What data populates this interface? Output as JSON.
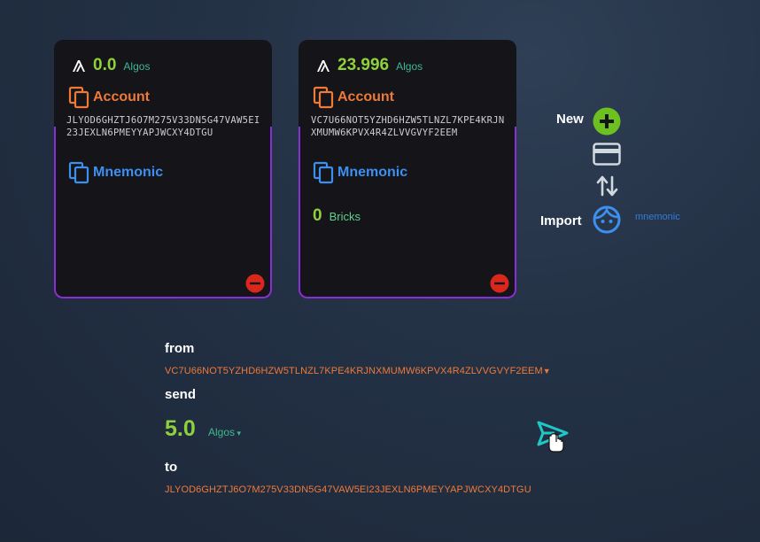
{
  "accounts": [
    {
      "balance": "0.0",
      "unit": "Algos",
      "account_label": "Account",
      "address": "JLYOD6GHZTJ6O7M275V33DN5G47VAW5EI23JEXLN6PMEYYAPJWCXY4DTGU",
      "mnemonic_label": "Mnemonic"
    },
    {
      "balance": "23.996",
      "unit": "Algos",
      "account_label": "Account",
      "address": "VC7U66NOT5YZHD6HZW5TLNZL7KPE4KRJNXMUMW6KPVX4R4ZLVVGVYF2EEM",
      "mnemonic_label": "Mnemonic",
      "bricks_value": "0",
      "bricks_unit": "Bricks"
    }
  ],
  "side": {
    "new_label": "New",
    "import_label": "Import",
    "mnemonic_hint": "mnemonic"
  },
  "transfer": {
    "from_label": "from",
    "from_address": "VC7U66NOT5YZHD6HZW5TLNZL7KPE4KRJNXMUMW6KPVX4R4ZLVVGVYF2EEM",
    "send_label": "send",
    "amount": "5.0",
    "unit": "Algos",
    "to_label": "to",
    "to_address": "JLYOD6GHZTJ6O7M275V33DN5G47VAW5EI23JEXLN6PMEYYAPJWCXY4DTGU"
  },
  "colors": {
    "card_border": "#8a2fd6",
    "balance_green": "#8ed13c",
    "account_orange": "#ee7a3a",
    "mnemonic_blue": "#3d8ff0",
    "remove_red": "#d9271c",
    "add_green": "#6cc01f",
    "send_teal": "#1fc7c7"
  },
  "icons": [
    "algorand-logo-icon",
    "copy-icon",
    "remove-icon",
    "add-icon",
    "card-icon",
    "swap-arrows-icon",
    "face-icon",
    "send-icon",
    "hand-cursor-icon"
  ]
}
